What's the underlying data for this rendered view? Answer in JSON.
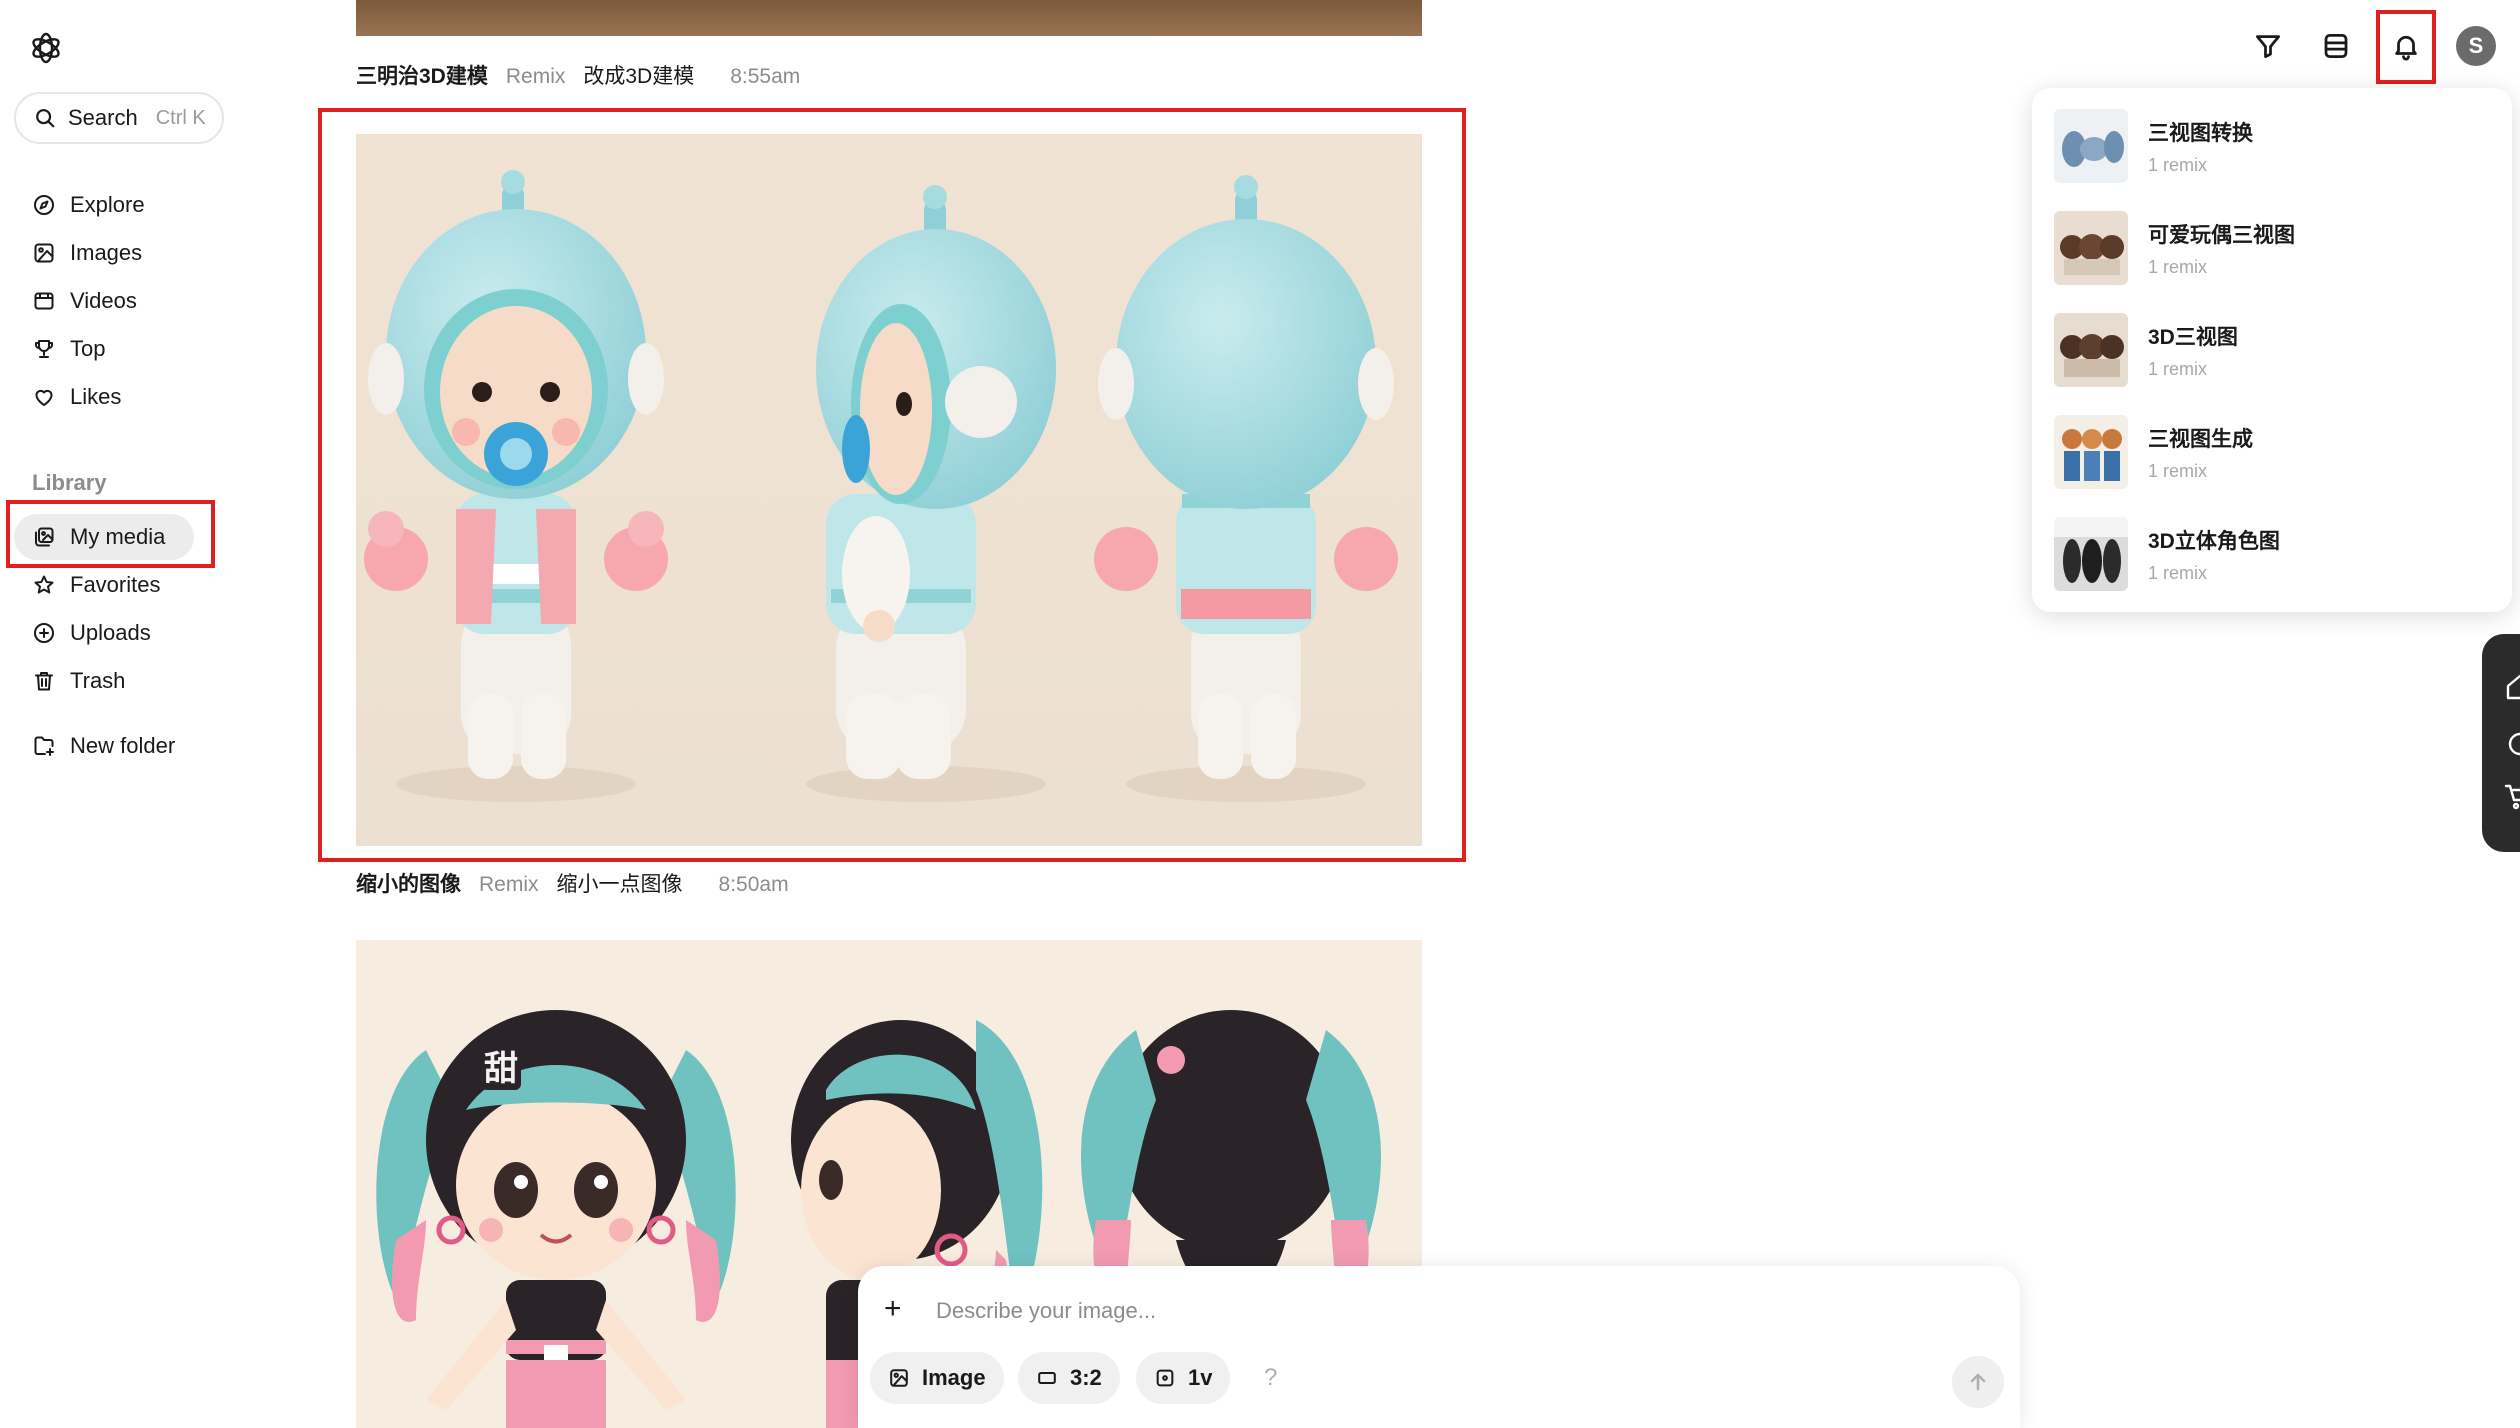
{
  "sidebar": {
    "search": {
      "label": "Search",
      "shortcut": "Ctrl K"
    },
    "nav": [
      {
        "label": "Explore",
        "icon": "compass-icon"
      },
      {
        "label": "Images",
        "icon": "image-icon"
      },
      {
        "label": "Videos",
        "icon": "video-icon"
      },
      {
        "label": "Top",
        "icon": "trophy-icon"
      },
      {
        "label": "Likes",
        "icon": "heart-icon"
      }
    ],
    "library_heading": "Library",
    "library": [
      {
        "label": "My media",
        "icon": "media-icon",
        "active": true
      },
      {
        "label": "Favorites",
        "icon": "star-icon"
      },
      {
        "label": "Uploads",
        "icon": "plus-circle-icon"
      },
      {
        "label": "Trash",
        "icon": "trash-icon"
      }
    ],
    "new_folder": {
      "label": "New folder",
      "icon": "folder-plus-icon"
    }
  },
  "feed": {
    "items": [
      {
        "title": "三明治3D建模",
        "tag": "Remix",
        "prompt": "改成3D建模",
        "time": "8:55am"
      },
      {
        "title": "缩小的图像",
        "tag": "Remix",
        "prompt": "缩小一点图像",
        "time": "8:50am"
      }
    ],
    "watermark_text": "甜"
  },
  "header_icons": [
    "filter-icon",
    "layers-icon",
    "bell-icon"
  ],
  "avatar": {
    "initial": "S"
  },
  "notifications": [
    {
      "title": "三视图转换",
      "sub": "1 remix"
    },
    {
      "title": "可爱玩偶三视图",
      "sub": "1 remix"
    },
    {
      "title": "3D三视图",
      "sub": "1 remix"
    },
    {
      "title": "三视图生成",
      "sub": "1 remix"
    },
    {
      "title": "3D立体角色图",
      "sub": "1 remix"
    }
  ],
  "composer": {
    "placeholder": "Describe your image...",
    "chips": {
      "type": "Image",
      "ratio": "3:2",
      "variants": "1v"
    },
    "help": "?"
  },
  "colors": {
    "highlight": "#e0201e",
    "active_nav_bg": "#ececec"
  }
}
